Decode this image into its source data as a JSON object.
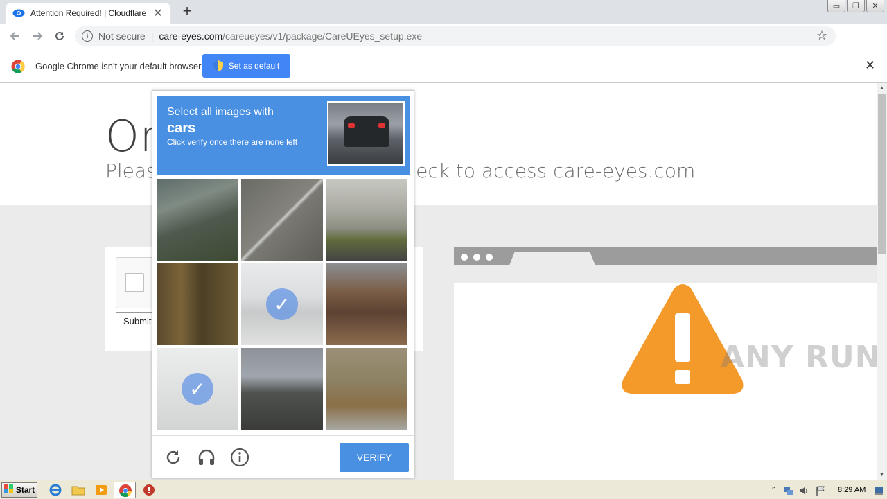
{
  "browser": {
    "tab_title": "Attention Required! | Cloudflare",
    "tab_close": "✕",
    "new_tab": "+",
    "security_label": "Not secure",
    "url_domain": "care-eyes.com",
    "url_path": "/careueyes/v1/package/CareUEyes_setup.exe",
    "window_controls": [
      "▭",
      "❐",
      "✕"
    ]
  },
  "infobar": {
    "message": "Google Chrome isn't your default browser",
    "button_label": "Set as default",
    "close": "✕"
  },
  "page": {
    "heading": "One",
    "subheading": "Please complete the security check to access care-eyes.com",
    "submit_label": "Submit"
  },
  "captcha": {
    "prompt_line1": "Select all images with",
    "prompt_target": "cars",
    "prompt_line3": "Click verify once there are none left",
    "tiles": [
      {
        "selected": false
      },
      {
        "selected": false
      },
      {
        "selected": false
      },
      {
        "selected": false
      },
      {
        "selected": true
      },
      {
        "selected": false
      },
      {
        "selected": true
      },
      {
        "selected": false
      },
      {
        "selected": false
      }
    ],
    "verify_label": "VERIFY",
    "accent_color": "#4a90e2"
  },
  "watermark": "ANY RUN",
  "taskbar": {
    "start_label": "Start",
    "clock": "8:29 AM"
  },
  "colors": {
    "infobar_button": "#4285f4",
    "warning": "#f39a2b"
  }
}
